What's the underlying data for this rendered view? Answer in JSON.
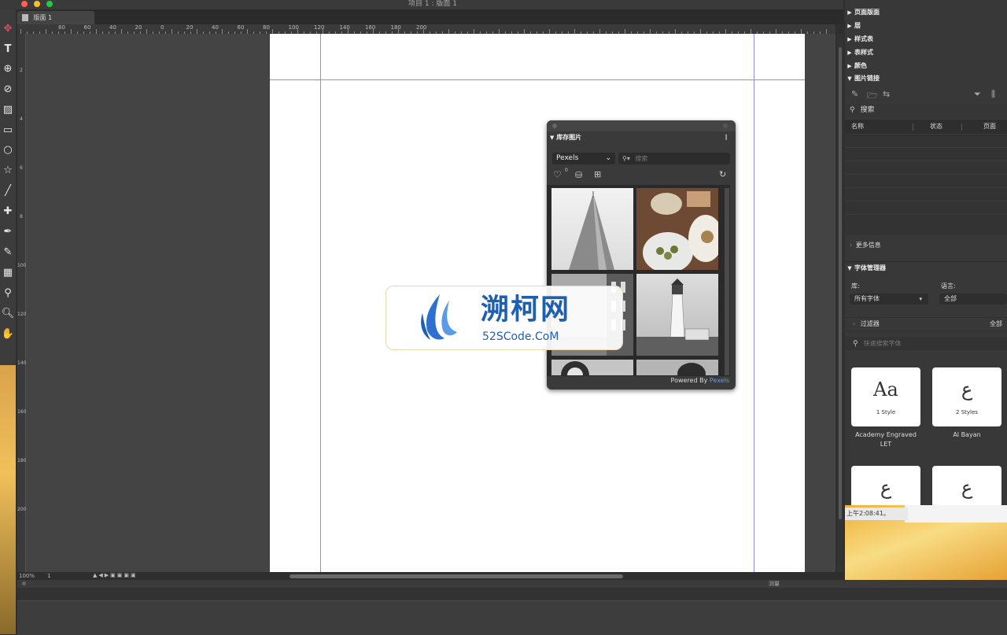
{
  "window": {
    "title": "项目 1 : 版面 1",
    "doc_tab": "版面 1"
  },
  "rulers": {
    "h_labels": [
      "80",
      "60",
      "40",
      "20",
      "0",
      "20",
      "40",
      "60",
      "80",
      "100",
      "120",
      "140",
      "160",
      "180",
      "200"
    ],
    "v_labels": [
      "2",
      "4",
      "6",
      "8",
      "100",
      "120",
      "140",
      "160",
      "180",
      "200"
    ]
  },
  "status": {
    "zoom": "100%",
    "page": "1"
  },
  "bottom_panel_label": "测量",
  "right_panels": {
    "collapsed": [
      "页面版面",
      "层",
      "样式表",
      "表样式",
      "颜色"
    ],
    "picture_links": {
      "title": "图片链接",
      "search_placeholder": "搜索",
      "columns": [
        "名称",
        "状态",
        "页面"
      ],
      "more_info": "更多信息"
    },
    "font_manager": {
      "title": "字体管理器",
      "library_label": "库:",
      "library_value": "所有字体",
      "language_label": "语言:",
      "language_value": "全部",
      "filter_label": "过滤器",
      "filter_all": "全部",
      "search_placeholder": "快速搜索字体",
      "fonts": [
        {
          "glyph": "Aa",
          "styles": "1 Style",
          "name": "Academy Engraved LET"
        },
        {
          "glyph": "ع",
          "styles": "2 Styles",
          "name": "Al Bayan"
        },
        {
          "glyph": "ع",
          "styles": "",
          "name": ""
        },
        {
          "glyph": "ع",
          "styles": "",
          "name": ""
        }
      ]
    }
  },
  "notification_time": "上午2:08:41。",
  "stock_panel": {
    "title": "库存图片",
    "provider": "Pexels",
    "search_placeholder": "搜索",
    "favorites_count": "0",
    "powered_by": "Powered By",
    "powered_link": "Pexels"
  },
  "watermark": {
    "title": "溯柯网",
    "subtitle": "52SCode.CoM"
  },
  "colors": {
    "accent": "#e8456b",
    "guide": "#8e8ee0",
    "link": "#5aa0e6"
  }
}
